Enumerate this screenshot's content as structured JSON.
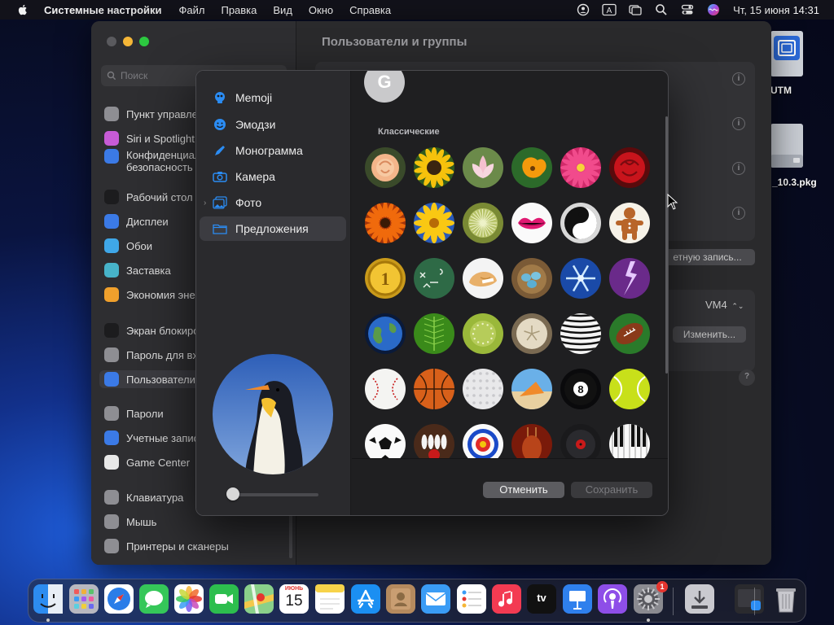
{
  "menubar": {
    "app_name": "Системные настройки",
    "menus": [
      "Файл",
      "Правка",
      "Вид",
      "Окно",
      "Справка"
    ],
    "clock": "Чт, 15 июня  14:31"
  },
  "desktop": {
    "items": [
      {
        "label": "UTM"
      },
      {
        "label": "_10.3.pkg"
      }
    ]
  },
  "settings": {
    "search_placeholder": "Поиск",
    "title": "Пользователи и группы",
    "sidebar": [
      {
        "label": "Пункт управления",
        "color": "#8e8e93"
      },
      {
        "label": "Siri и Spotlight",
        "color": "#c75bd6"
      },
      {
        "label": "Конфиденциальность и безопасность",
        "color": "#3b7ae6"
      },
      {
        "label": "Рабочий стол и Dock",
        "color": "#1c1c1e"
      },
      {
        "label": "Дисплеи",
        "color": "#3b7ae6"
      },
      {
        "label": "Обои",
        "color": "#3fa7e8"
      },
      {
        "label": "Заставка",
        "color": "#47b3c9"
      },
      {
        "label": "Экономия энергии",
        "color": "#f0a02c"
      },
      {
        "label": "Экран блокировки",
        "color": "#1c1c1e"
      },
      {
        "label": "Пароль для входа",
        "color": "#8e8e93"
      },
      {
        "label": "Пользователи и группы",
        "color": "#3b7ae6"
      },
      {
        "label": "Пароли",
        "color": "#8e8e93"
      },
      {
        "label": "Учетные записи интернета",
        "color": "#3b7ae6"
      },
      {
        "label": "Game Center",
        "color": "#e8e8e8"
      },
      {
        "label": "Клавиатура",
        "color": "#8e8e93"
      },
      {
        "label": "Мышь",
        "color": "#8e8e93"
      },
      {
        "label": "Принтеры и сканеры",
        "color": "#8e8e93"
      }
    ],
    "content": {
      "account_button": "етную запись...",
      "vm_label": "VM4",
      "change_button": "Изменить...",
      "help": "?"
    }
  },
  "dialog": {
    "categories": [
      {
        "label": "Memoji",
        "icon": "memoji-icon"
      },
      {
        "label": "Эмодзи",
        "icon": "emoji-icon"
      },
      {
        "label": "Монограмма",
        "icon": "pencil-icon"
      },
      {
        "label": "Камера",
        "icon": "camera-icon"
      },
      {
        "label": "Фото",
        "icon": "photos-icon"
      },
      {
        "label": "Предложения",
        "icon": "folder-icon"
      }
    ],
    "active_category": "Предложения",
    "monogram_letter": "G",
    "section_title": "Классические",
    "pictures": [
      "rose-peach",
      "sunflower",
      "lotus",
      "poppy",
      "dahlia",
      "red-rose",
      "orange-flower",
      "yellow-daisy",
      "dandelion",
      "lips",
      "yin-yang",
      "gingerbread",
      "coin",
      "chalkboard",
      "fortune-cookie",
      "eggs-nest",
      "snowflake",
      "lightning",
      "earth",
      "leaf",
      "cactus",
      "sand-dollar",
      "zebra",
      "football",
      "baseball",
      "basketball",
      "golf-ball",
      "beach",
      "eight-ball",
      "tennis-ball",
      "soccer-ball",
      "bowling",
      "target",
      "violin",
      "turntable",
      "piano"
    ],
    "cancel_label": "Отменить",
    "save_label": "Сохранить",
    "zoom": 0.0
  },
  "dock": {
    "apps": [
      {
        "name": "finder",
        "color": "#2d8cf0",
        "running": true
      },
      {
        "name": "launchpad",
        "color": "#9a9aa0",
        "running": false
      },
      {
        "name": "safari",
        "color": "#2a7de8",
        "running": false
      },
      {
        "name": "messages",
        "color": "#35c759",
        "running": false
      },
      {
        "name": "photos",
        "color": "#f2f2f2",
        "running": false
      },
      {
        "name": "facetime",
        "color": "#2dbe4e",
        "running": false
      },
      {
        "name": "maps",
        "color": "#5ac26b",
        "running": false
      },
      {
        "name": "calendar",
        "color": "#ffffff",
        "running": false
      },
      {
        "name": "notes",
        "color": "#f7d34a",
        "running": false
      },
      {
        "name": "app-store",
        "color": "#1b8ff2",
        "running": false
      },
      {
        "name": "contacts",
        "color": "#b58a5e",
        "running": false
      },
      {
        "name": "mail",
        "color": "#3a9cf5",
        "running": false
      },
      {
        "name": "reminders",
        "color": "#ffffff",
        "running": false
      },
      {
        "name": "music",
        "color": "#f33b52",
        "running": false
      },
      {
        "name": "tv",
        "color": "#111111",
        "running": false
      },
      {
        "name": "keynote",
        "color": "#2f80ed",
        "running": false
      },
      {
        "name": "podcasts",
        "color": "#8e4ee8",
        "running": false
      },
      {
        "name": "system-settings",
        "color": "#8a8a90",
        "running": true
      },
      {
        "name": "downloads",
        "color": "#c9c9cf",
        "running": false
      },
      {
        "name": "screenshot",
        "color": "#2a2a2e",
        "running": false
      },
      {
        "name": "trash",
        "color": "#a8a8ae",
        "running": false
      }
    ],
    "calendar_month": "ИЮНЬ",
    "calendar_day": "15",
    "tv_label": "tv",
    "settings_badge": "1"
  }
}
